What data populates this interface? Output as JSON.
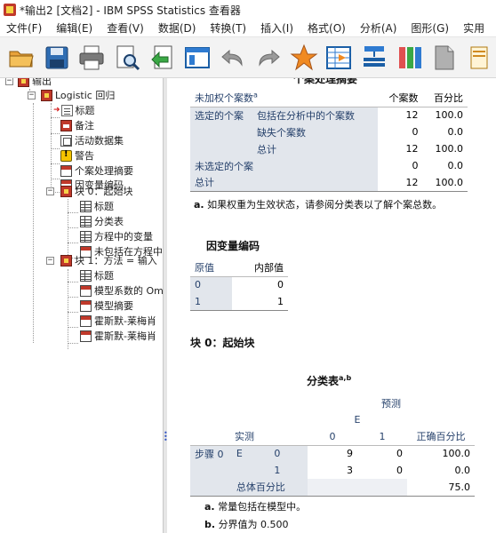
{
  "window": {
    "title": "*输出2 [文档2] - IBM SPSS Statistics 查看器"
  },
  "menu": [
    "文件(F)",
    "编辑(E)",
    "查看(V)",
    "数据(D)",
    "转换(T)",
    "插入(I)",
    "格式(O)",
    "分析(A)",
    "图形(G)",
    "实用"
  ],
  "toolbar": [
    "open-icon",
    "save-icon",
    "print-icon",
    "print-preview-icon",
    "export-icon",
    "goto-data-icon",
    "undo-icon",
    "redo-icon",
    "star-icon",
    "goto-case-icon",
    "variables-icon",
    "columns-icon",
    "page-icon",
    "notes-icon"
  ],
  "nav": {
    "root": "输出",
    "logistic": "Logistic 回归",
    "items": [
      "标题",
      "备注",
      "活动数据集",
      "警告",
      "个案处理摘要",
      "因变量编码"
    ],
    "block0": "块 0：起始块",
    "block0_items": [
      "标题",
      "分类表",
      "方程中的变量",
      "未包括在方程中"
    ],
    "block1": "块 1：方法 = 输入",
    "block1_items": [
      "标题",
      "模型系数的 Om",
      "模型摘要",
      "霍斯默-莱梅肖",
      "霍斯默-莱梅肖"
    ]
  },
  "case_summary": {
    "title": "个案处理摘要",
    "col_label": "未加权个案数",
    "col_label_sup": "a",
    "col_n": "个案数",
    "col_pct": "百分比",
    "selected": "选定的个案",
    "rows": [
      {
        "sub": "包括在分析中的个案数",
        "n": "12",
        "pct": "100.0"
      },
      {
        "sub": "缺失个案数",
        "n": "0",
        "pct": "0.0"
      },
      {
        "sub": "总计",
        "n": "12",
        "pct": "100.0"
      }
    ],
    "unselected": "未选定的个案",
    "unselected_n": "0",
    "unselected_pct": "0.0",
    "total": "总计",
    "total_n": "12",
    "total_pct": "100.0",
    "footnote_a": "a.",
    "footnote": "如果权重为生效状态，请参阅分类表以了解个案总数。"
  },
  "dep_coding": {
    "title": "因变量编码",
    "col_orig": "原值",
    "col_internal": "内部值",
    "rows": [
      {
        "orig": "0",
        "internal": "0"
      },
      {
        "orig": "1",
        "internal": "1"
      }
    ]
  },
  "block0_heading": "块 0：起始块",
  "classification": {
    "title": "分类表",
    "title_sup": "a,b",
    "predicted": "预测",
    "var": "E",
    "observed": "实测",
    "col0": "0",
    "col1": "1",
    "col_pct": "正确百分比",
    "step": "步骤 0",
    "rows": [
      {
        "val": "0",
        "c0": "9",
        "c1": "0",
        "pct": "100.0"
      },
      {
        "val": "1",
        "c0": "3",
        "c1": "0",
        "pct": "0.0"
      }
    ],
    "overall": "总体百分比",
    "overall_pct": "75.0",
    "footnote_a_label": "a.",
    "footnote_a": "常量包括在模型中。",
    "footnote_b_label": "b.",
    "footnote_b": "分界值为 0.500"
  }
}
